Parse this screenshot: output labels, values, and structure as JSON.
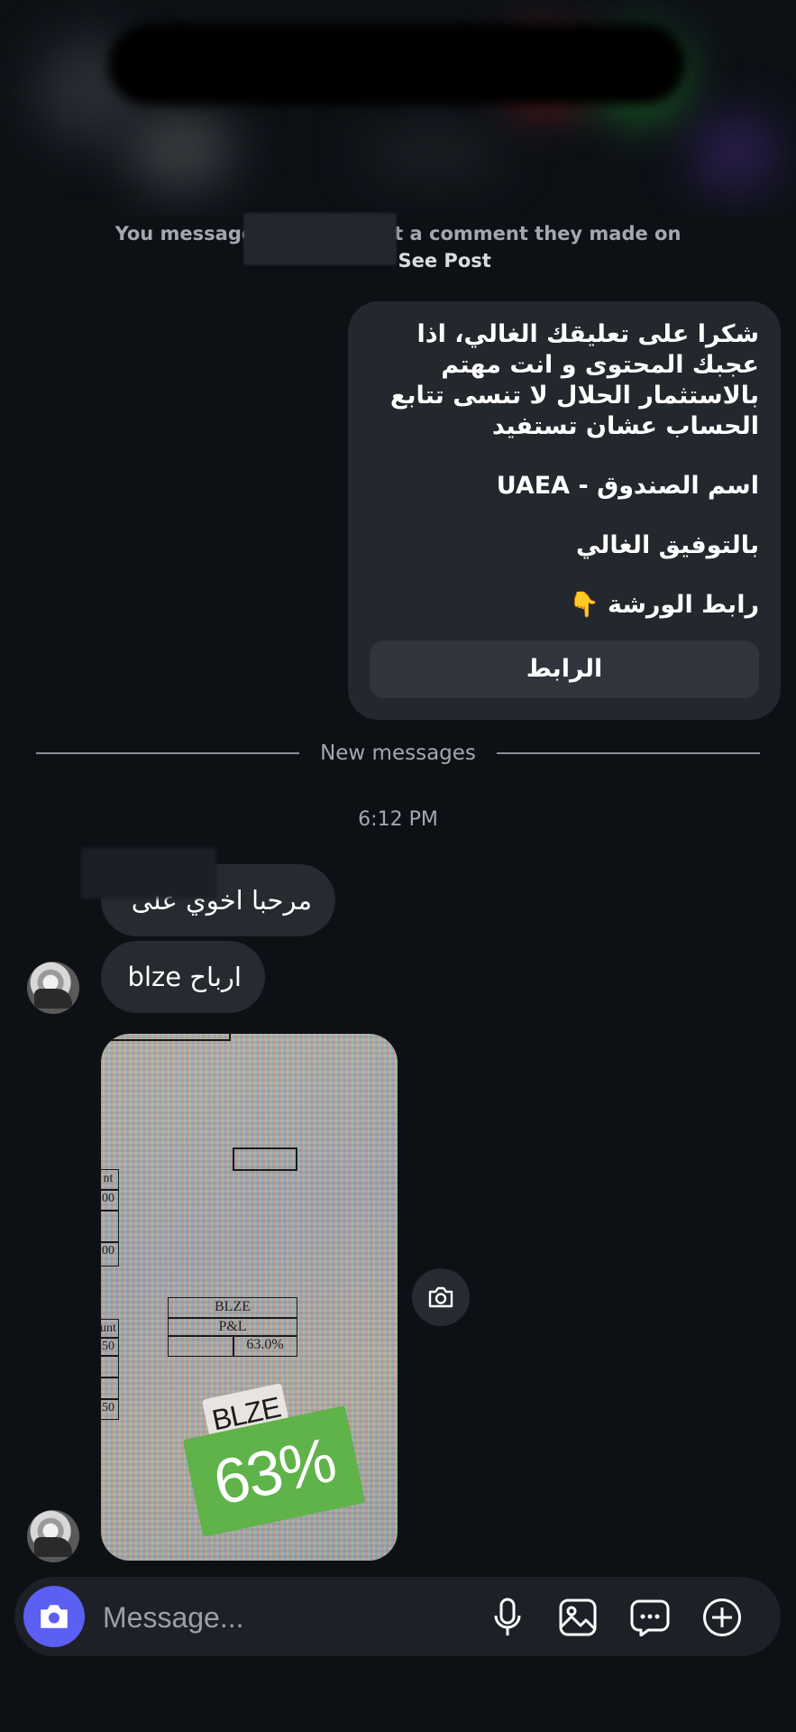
{
  "thread": {
    "context_prefix": "You message",
    "context_middle": "bout a comment they made on",
    "see_post": "See Post"
  },
  "sent_message": {
    "lines": [
      "شكرا على تعليقك الغالي، اذا عجبك المحتوى و انت مهتم بالاستثمار الحلال لا تنسى تتابع الحساب عشان تستفيد",
      "اسم الصندوق - UAEA",
      "بالتوفيق الغالي",
      "رابط الورشة 👇"
    ],
    "button_label": "الرابط"
  },
  "divider": {
    "label": "New messages"
  },
  "timestamp": "6:12 PM",
  "received_messages": [
    {
      "text": "مرحبا اخوي على"
    },
    {
      "text": "ارباح blze"
    }
  ],
  "image_message": {
    "table_lines": [
      "BLZE",
      "P&L",
      "63.0%"
    ],
    "left_edge_labels": [
      "nt",
      "00",
      "00",
      "unt",
      "50",
      "50"
    ],
    "sticker_name": "BLZE",
    "sticker_percent": "63%"
  },
  "composer": {
    "placeholder": "Message..."
  },
  "colors": {
    "background": "#0d1116",
    "bubble": "#262a31",
    "accent": "#5b5ff2",
    "percent_tag": "#5fb349"
  }
}
